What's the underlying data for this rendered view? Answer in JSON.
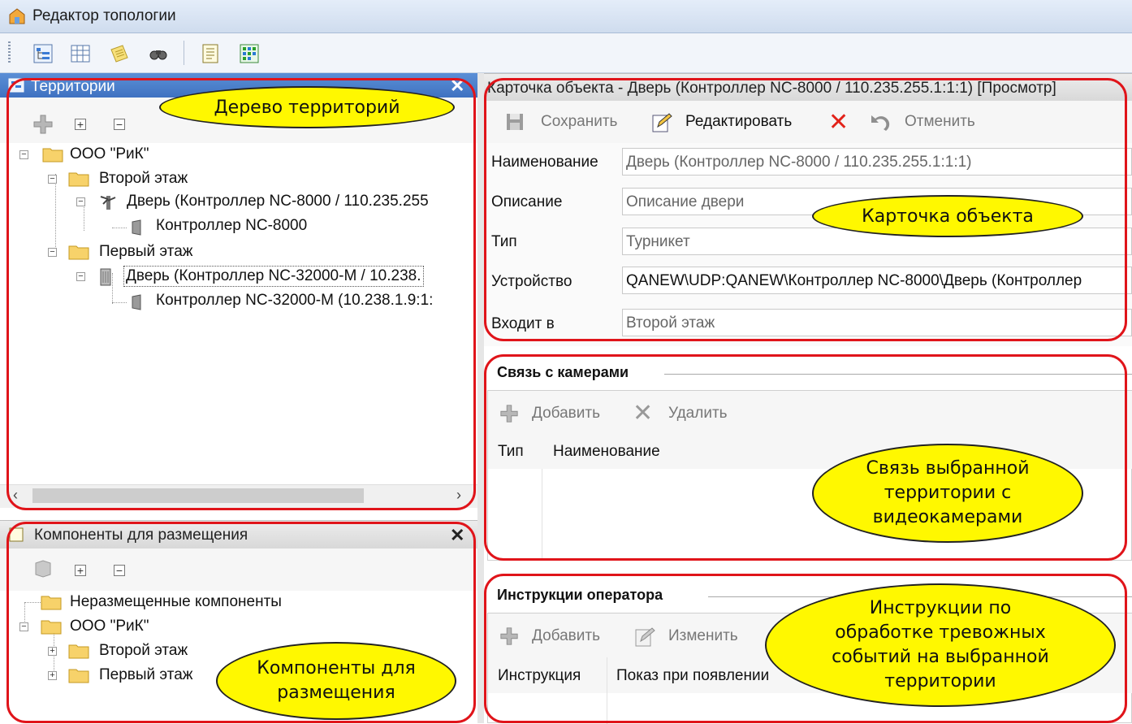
{
  "window": {
    "title": "Редактор топологии"
  },
  "territories": {
    "title": "Территории",
    "tree": [
      {
        "label": "ООО \"РиК\""
      },
      {
        "label": "Второй этаж"
      },
      {
        "label": "Дверь (Контроллер NC-8000 / 110.235.255"
      },
      {
        "label": "Контроллер NC-8000"
      },
      {
        "label": "Первый этаж"
      },
      {
        "label": "Дверь (Контроллер NC-32000-M / 10.238."
      },
      {
        "label": "Контроллер NC-32000-M (10.238.1.9:1:"
      }
    ],
    "callout": "Дерево территорий"
  },
  "components": {
    "title": "Компоненты для размещения",
    "tree": [
      {
        "label": "Неразмещенные компоненты"
      },
      {
        "label": "ООО \"РиК\""
      },
      {
        "label": "Второй этаж"
      },
      {
        "label": "Первый этаж"
      }
    ],
    "callout_line1": "Компоненты для",
    "callout_line2": "размещения"
  },
  "card": {
    "title": "Карточка объекта - Дверь (Контроллер NC-8000 / 110.235.255.1:1:1) [Просмотр]",
    "save": "Сохранить",
    "edit": "Редактировать",
    "cancel": "Отменить",
    "fields": [
      {
        "label": "Наименование",
        "value": "Дверь (Контроллер NC-8000 / 110.235.255.1:1:1)"
      },
      {
        "label": "Описание",
        "value": "Описание двери"
      },
      {
        "label": "Тип",
        "value": "Турникет"
      },
      {
        "label": "Устройство",
        "value": "QANEW\\UDP:QANEW\\Контроллер NC-8000\\Дверь (Контроллер"
      },
      {
        "label": "Входит в",
        "value": "Второй этаж"
      }
    ],
    "callout": "Карточка объекта"
  },
  "cameras": {
    "title": "Связь с камерами",
    "add": "Добавить",
    "delete": "Удалить",
    "col_type": "Тип",
    "col_name": "Наименование",
    "callout_line1": "Связь выбранной",
    "callout_line2": "территории с",
    "callout_line3": "видеокамерами"
  },
  "instructions": {
    "title": "Инструкции оператора",
    "add": "Добавить",
    "change": "Изменить",
    "col_instruction": "Инструкция",
    "col_show": "Показ при появлении",
    "callout_line1": "Инструкции по",
    "callout_line2": "обработке тревожных",
    "callout_line3": "событий на выбранной",
    "callout_line4": "территории"
  },
  "colors": {
    "annotation_frame": "#e0141a",
    "callout_fill": "#fff800",
    "panel_header": "#4a7fcc"
  }
}
